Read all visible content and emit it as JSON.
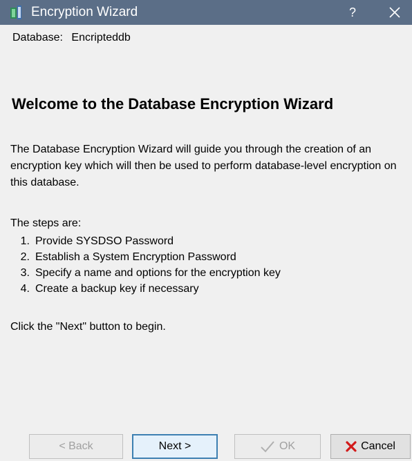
{
  "window": {
    "title": "Encryption Wizard",
    "help_label": "?"
  },
  "database": {
    "label": "Database:",
    "value": "Encripteddb"
  },
  "heading": "Welcome to the Database Encryption Wizard",
  "intro": "The Database Encryption Wizard will guide you through the creation of an encryption key which will then be used to perform database-level encryption on this database.",
  "steps_label": "The steps are:",
  "steps": [
    {
      "num": "1.",
      "text": "Provide SYSDSO Password"
    },
    {
      "num": "2.",
      "text": "Establish a System Encryption Password"
    },
    {
      "num": "3.",
      "text": "Specify a name and options for the encryption key"
    },
    {
      "num": "4.",
      "text": "Create a backup key if necessary"
    }
  ],
  "begin_text": "Click the \"Next\" button to begin.",
  "buttons": {
    "back": "< Back",
    "next": "Next >",
    "ok": "OK",
    "cancel": "Cancel"
  }
}
